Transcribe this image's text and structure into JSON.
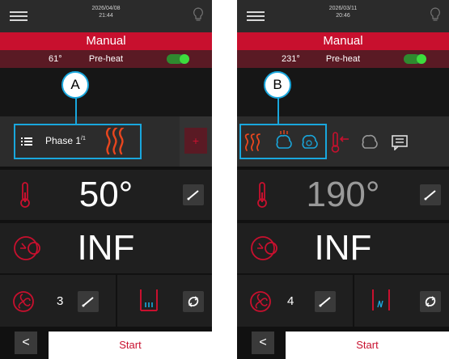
{
  "left": {
    "datetime": {
      "date": "2026/04/08",
      "time": "21:44"
    },
    "mode": "Manual",
    "preheat": {
      "temp": "61°",
      "label": "Pre-heat"
    },
    "callout": "A",
    "phase_label": "Phase 1",
    "phase_sup": "/1",
    "plus": "+",
    "temperature": "50°",
    "time": "INF",
    "fan_speed": "3",
    "start": "Start",
    "back": "<"
  },
  "right": {
    "datetime": {
      "date": "2026/03/11",
      "time": "20:46"
    },
    "mode": "Manual",
    "preheat": {
      "temp": "231°",
      "label": "Pre-heat"
    },
    "callout": "B",
    "temperature": "190°",
    "time": "INF",
    "fan_speed": "4",
    "start": "Start",
    "back": "<"
  },
  "colors": {
    "accent": "#c8102e",
    "highlight": "#19a7dd",
    "heat": "#e8461e",
    "steam": "#19a7dd",
    "toggle_on": "#3ddc3d"
  },
  "icons": [
    "menu-icon",
    "bulb-icon",
    "phase-list-icon",
    "heat-waves-icon",
    "steam-fan-icon",
    "thermometer-icon",
    "clock-icon",
    "fan-icon",
    "edit-icon",
    "heating-element-icon",
    "rotate-icon",
    "comment-icon",
    "probe-icon",
    "plus-icon"
  ]
}
